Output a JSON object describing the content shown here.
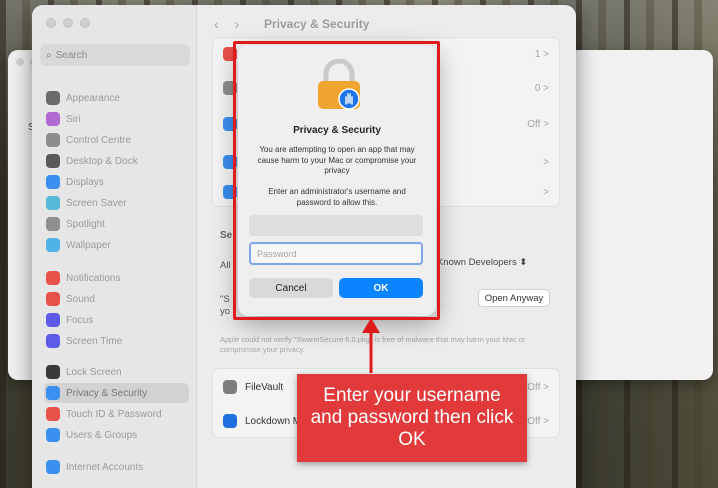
{
  "sidebar": {
    "search_placeholder": "Search",
    "items": [
      {
        "label": "Appearance",
        "icon": "appearance-icon",
        "color": "#6b6b6b"
      },
      {
        "label": "Siri",
        "icon": "siri-icon",
        "color": "#b06ad0"
      },
      {
        "label": "Control Centre",
        "icon": "control-centre-icon",
        "color": "#8d8d8d"
      },
      {
        "label": "Desktop & Dock",
        "icon": "desktop-dock-icon",
        "color": "#5a5a5a"
      },
      {
        "label": "Displays",
        "icon": "displays-icon",
        "color": "#3b8ff0"
      },
      {
        "label": "Screen Saver",
        "icon": "screen-saver-icon",
        "color": "#56b9d8"
      },
      {
        "label": "Spotlight",
        "icon": "spotlight-icon",
        "color": "#8e8e8e"
      },
      {
        "label": "Wallpaper",
        "icon": "wallpaper-icon",
        "color": "#4fb3e8"
      },
      {
        "label": "Notifications",
        "icon": "notifications-icon",
        "color": "#e8504a"
      },
      {
        "label": "Sound",
        "icon": "sound-icon",
        "color": "#e8504a"
      },
      {
        "label": "Focus",
        "icon": "focus-icon",
        "color": "#5e5ce6"
      },
      {
        "label": "Screen Time",
        "icon": "screen-time-icon",
        "color": "#5e5ce6"
      },
      {
        "label": "Lock Screen",
        "icon": "lock-screen-icon",
        "color": "#3a3a3a"
      },
      {
        "label": "Privacy & Security",
        "icon": "privacy-hand-icon",
        "color": "#3b8ff0",
        "selected": true
      },
      {
        "label": "Touch ID & Password",
        "icon": "fingerprint-icon",
        "color": "#e8504a"
      },
      {
        "label": "Users & Groups",
        "icon": "users-icon",
        "color": "#3b8ff0"
      },
      {
        "label": "Internet Accounts",
        "icon": "at-icon",
        "color": "#3b8ff0"
      }
    ]
  },
  "content": {
    "title": "Privacy & Security",
    "rows_top": [
      {
        "right": "1 >"
      },
      {
        "right": "0 >"
      },
      {
        "right": "Off >"
      },
      {
        "right": ">"
      },
      {
        "right": ">"
      }
    ],
    "section_prefix": "Se",
    "allow_prefix": "All",
    "developers_select": "& Known Developers ⬍",
    "blocked_prefix": "\"S",
    "blocked_prefix2": "yo",
    "open_anyway": "Open Anyway",
    "warning_text": "Apple could not verify \"SwannSecure 6.0.pkg\" is free of malware that may harm your Mac or compromise your privacy.",
    "filevault_label": "FileVault",
    "filevault_right": "Off >",
    "lockdown_label": "Lockdown M",
    "lockdown_right": "Off >",
    "help": "?"
  },
  "dialog": {
    "title": "Privacy & Security",
    "message": "You are attempting to open an app that may cause harm to your Mac or compromise your privacy",
    "prompt": "Enter an administrator's username and password to allow this.",
    "username_value": "",
    "password_placeholder": "Password",
    "cancel_label": "Cancel",
    "ok_label": "OK"
  },
  "annotation": {
    "callout_text": "Enter your username and password then click OK",
    "color": "#e01b1b"
  },
  "back_window": {
    "letter": "S"
  }
}
